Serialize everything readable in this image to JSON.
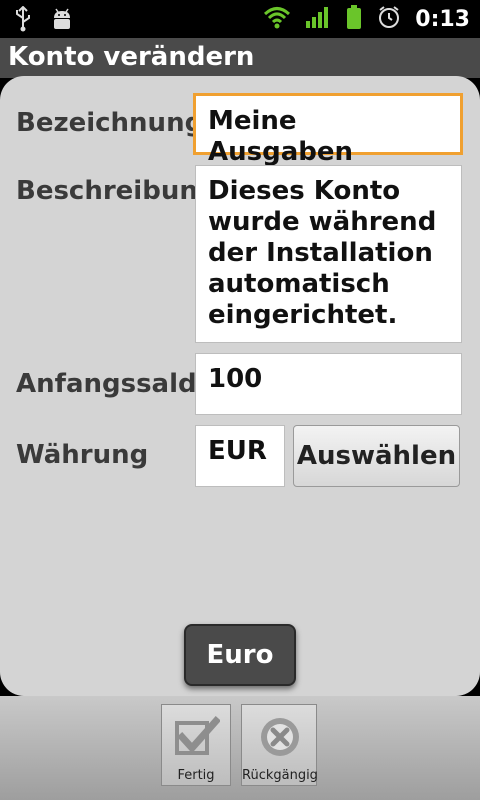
{
  "status": {
    "time": "0:13",
    "icons": [
      "usb-icon",
      "android-debug-icon",
      "wifi-icon",
      "signal-icon",
      "battery-icon",
      "alarm-icon"
    ]
  },
  "header": {
    "title": "Konto verändern"
  },
  "form": {
    "name": {
      "label": "Bezeichnung",
      "value": "Meine Ausgaben"
    },
    "description": {
      "label": "Beschreibung",
      "value": "Dieses Konto wurde während der Installation automatisch eingerichtet."
    },
    "opening_balance": {
      "label": "Anfangssaldo",
      "value": "100"
    },
    "currency": {
      "label": "Währung",
      "value": "EUR",
      "select_label": "Auswählen"
    }
  },
  "toast": {
    "text": "Euro"
  },
  "toolbar": {
    "done_label": "Fertig",
    "undo_label": "Rückgängig"
  },
  "colors": {
    "focus": "#f0a030",
    "panel": "#d4d4d4",
    "titlebar": "#4a4a4a"
  }
}
